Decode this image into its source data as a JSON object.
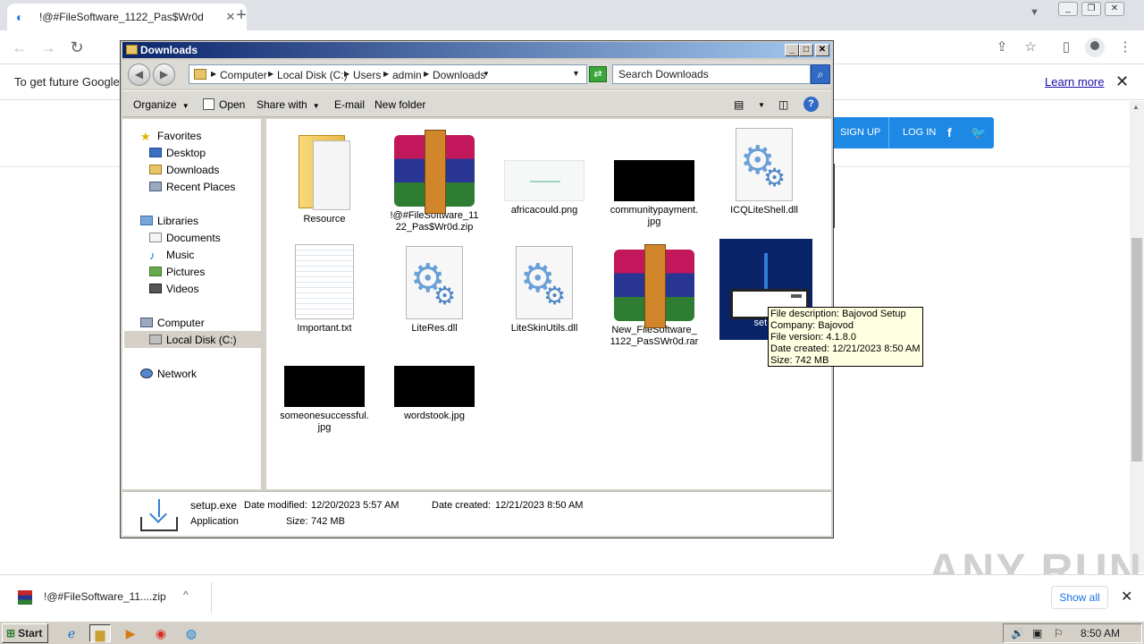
{
  "browser": {
    "tab_title": "!@#FileSoftware_1122_Pas$Wr0d",
    "tab_close": "✕",
    "new_tab": "+",
    "nav": {
      "back": "←",
      "forward": "→",
      "reload": "↻"
    },
    "infobar_text": "To get future Google",
    "infobar_link": "Learn more",
    "infobar_close": "✕",
    "site_buttons": {
      "signup": "SIGN UP",
      "login": "LOG IN",
      "facebook": "f",
      "twitter": "🐦"
    },
    "downloads_bar": {
      "item_name": "!@#FileSoftware_11....zip",
      "chevron": "^",
      "show_all": "Show all",
      "close": "✕"
    },
    "watermark": "ANY RUN"
  },
  "explorer": {
    "title": "Downloads",
    "controls": {
      "minimize": "_",
      "maximize": "□",
      "close": "✕"
    },
    "breadcrumbs": [
      "Computer",
      "Local Disk (C:)",
      "Users",
      "admin",
      "Downloads"
    ],
    "search_placeholder": "Search Downloads",
    "commands": {
      "organize": "Organize",
      "open": "Open",
      "share_with": "Share with",
      "email": "E-mail",
      "new_folder": "New folder",
      "help": "?"
    },
    "nav_pane": {
      "favorites": "Favorites",
      "desktop": "Desktop",
      "downloads": "Downloads",
      "recent_places": "Recent Places",
      "libraries": "Libraries",
      "documents": "Documents",
      "music": "Music",
      "pictures": "Pictures",
      "videos": "Videos",
      "computer": "Computer",
      "local_disk": "Local Disk (C:)",
      "network": "Network"
    },
    "files": [
      {
        "name": "Resource",
        "icon": "folder-icon"
      },
      {
        "name": "!@#FileSoftware_1122_Pas$Wr0d.zip",
        "icon": "winrar-archive-icon"
      },
      {
        "name": "africacould.png",
        "icon": "image-thumbnail"
      },
      {
        "name": "communitypayment.jpg",
        "icon": "image-thumbnail"
      },
      {
        "name": "ICQLiteShell.dll",
        "icon": "dll-gear-icon"
      },
      {
        "name": "Important.txt",
        "icon": "text-file-icon"
      },
      {
        "name": "LiteRes.dll",
        "icon": "dll-gear-icon"
      },
      {
        "name": "LiteSkinUtils.dll",
        "icon": "dll-gear-icon"
      },
      {
        "name": "New_FileSoftware_1122_PasSWr0d.rar",
        "icon": "winrar-archive-icon"
      },
      {
        "name": "setup",
        "icon": "installer-icon",
        "selected": true
      },
      {
        "name": "someonesuccessful.jpg",
        "icon": "image-thumbnail"
      },
      {
        "name": "wordstook.jpg",
        "icon": "image-thumbnail"
      }
    ],
    "tooltip": {
      "description": "File description: Bajovod Setup",
      "company": "Company: Bajovod",
      "version": "File version: 4.1.8.0",
      "created": "Date created: 12/21/2023 8:50 AM",
      "size": "Size: 742 MB"
    },
    "details": {
      "name": "setup.exe",
      "modified_label": "Date modified:",
      "modified": "12/20/2023 5:57 AM",
      "created_label": "Date created:",
      "created": "12/21/2023 8:50 AM",
      "type": "Application",
      "size_label": "Size:",
      "size": "742 MB"
    }
  },
  "taskbar": {
    "start": "Start",
    "time": "8:50 AM"
  },
  "colors": {
    "title_bar": "#0a246a",
    "selection": "#0a246a",
    "site_accent": "#1e88e5",
    "tooltip_bg": "#ffffe1"
  }
}
